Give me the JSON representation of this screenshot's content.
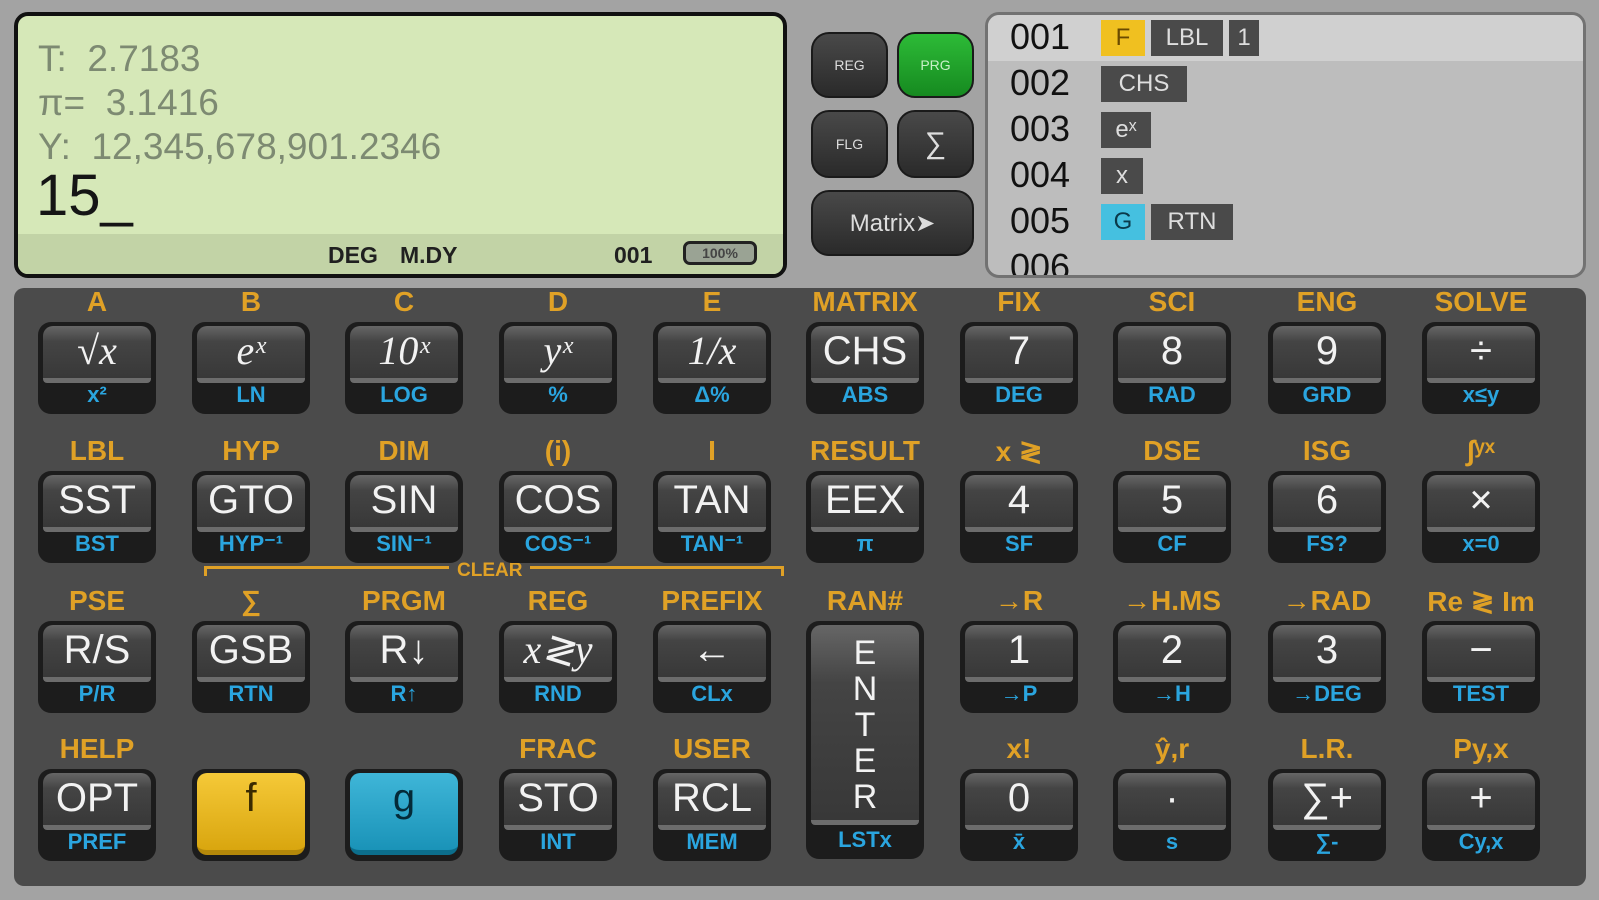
{
  "lcd": {
    "t_line": "T:  2.7183",
    "pi_line": "π=  3.1416",
    "y_line": "Y:  12,345,678,901.2346",
    "entry": "15_",
    "status_angle": "DEG",
    "status_date": "M.DY",
    "status_step": "001",
    "battery": "100%"
  },
  "mode_buttons": {
    "reg": "REG",
    "prg": "PRG",
    "flg": "FLG",
    "sum": "∑",
    "matrix": "Matrix➤"
  },
  "program": {
    "rows": [
      {
        "num": "001",
        "tokens": [
          "F",
          "LBL",
          "1"
        ]
      },
      {
        "num": "002",
        "tokens": [
          "CHS"
        ]
      },
      {
        "num": "003",
        "tokens": [
          "eˣ"
        ]
      },
      {
        "num": "004",
        "tokens": [
          "x"
        ]
      },
      {
        "num": "005",
        "tokens": [
          "G",
          "RTN"
        ]
      },
      {
        "num": "006",
        "tokens": []
      }
    ]
  },
  "keypad": {
    "clear_label": "CLEAR",
    "keys": [
      {
        "above": "A",
        "main": "√x",
        "sub": "x²"
      },
      {
        "above": "B",
        "main": "eˣ",
        "sub": "LN"
      },
      {
        "above": "C",
        "main": "10ˣ",
        "sub": "LOG"
      },
      {
        "above": "D",
        "main": "yˣ",
        "sub": "%"
      },
      {
        "above": "E",
        "main": "1/x",
        "sub": "Δ%"
      },
      {
        "above": "MATRIX",
        "main": "CHS",
        "sub": "ABS"
      },
      {
        "above": "FIX",
        "main": "7",
        "sub": "DEG"
      },
      {
        "above": "SCI",
        "main": "8",
        "sub": "RAD"
      },
      {
        "above": "ENG",
        "main": "9",
        "sub": "GRD"
      },
      {
        "above": "SOLVE",
        "main": "÷",
        "sub": "x≤y"
      },
      {
        "above": "LBL",
        "main": "SST",
        "sub": "BST"
      },
      {
        "above": "HYP",
        "main": "GTO",
        "sub": "HYP⁻¹"
      },
      {
        "above": "DIM",
        "main": "SIN",
        "sub": "SIN⁻¹"
      },
      {
        "above": "(i)",
        "main": "COS",
        "sub": "COS⁻¹"
      },
      {
        "above": "I",
        "main": "TAN",
        "sub": "TAN⁻¹"
      },
      {
        "above": "RESULT",
        "main": "EEX",
        "sub": "π"
      },
      {
        "above": "x ≷",
        "main": "4",
        "sub": "SF"
      },
      {
        "above": "DSE",
        "main": "5",
        "sub": "CF"
      },
      {
        "above": "ISG",
        "main": "6",
        "sub": "FS?"
      },
      {
        "above": "∫ʸˣ",
        "main": "×",
        "sub": "x=0"
      },
      {
        "above": "PSE",
        "main": "R/S",
        "sub": "P/R"
      },
      {
        "above": "∑",
        "main": "GSB",
        "sub": "RTN"
      },
      {
        "above": "PRGM",
        "main": "R↓",
        "sub": "R↑"
      },
      {
        "above": "REG",
        "main": "x≷y",
        "sub": "RND"
      },
      {
        "above": "PREFIX",
        "main": "←",
        "sub": "CLx"
      },
      {
        "above": "RAN#",
        "main": "ENTER",
        "sub": "LSTx"
      },
      {
        "above": "→R",
        "main": "1",
        "sub": "→P"
      },
      {
        "above": "→H.MS",
        "main": "2",
        "sub": "→H"
      },
      {
        "above": "→RAD",
        "main": "3",
        "sub": "→DEG"
      },
      {
        "above": "Re ≷ Im",
        "main": "−",
        "sub": "TEST"
      },
      {
        "above": "HELP",
        "main": "OPT",
        "sub": "PREF"
      },
      {
        "above": "",
        "main": "f",
        "sub": ""
      },
      {
        "above": "",
        "main": "g",
        "sub": ""
      },
      {
        "above": "FRAC",
        "main": "STO",
        "sub": "INT"
      },
      {
        "above": "USER",
        "main": "RCL",
        "sub": "MEM"
      },
      {
        "above": "x!",
        "main": "0",
        "sub": "x̄"
      },
      {
        "above": "ŷ,r",
        "main": "·",
        "sub": "s"
      },
      {
        "above": "L.R.",
        "main": "∑+",
        "sub": "∑-"
      },
      {
        "above": "Py,x",
        "main": "+",
        "sub": "Cy,x"
      }
    ]
  },
  "colors": {
    "lcd_bg": "#d6e8b8",
    "gold_label": "#e0a126",
    "blue_label": "#2aa5df",
    "prg_active": "#1f9a2a"
  }
}
